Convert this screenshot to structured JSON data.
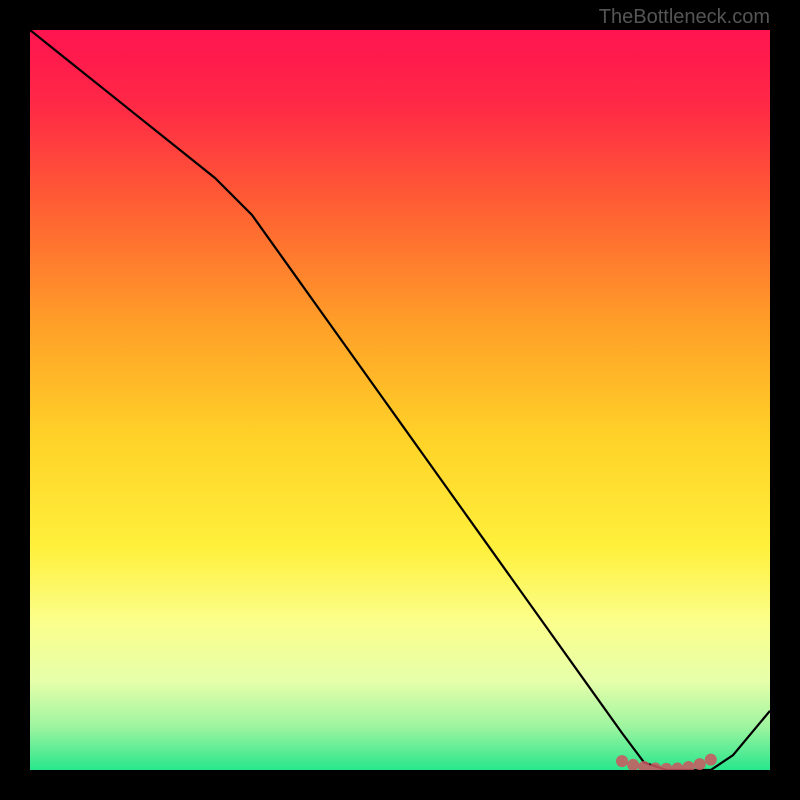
{
  "watermark": "TheBottleneck.com",
  "chart_data": {
    "type": "line",
    "title": "",
    "xlabel": "",
    "ylabel": "",
    "xlim": [
      0,
      100
    ],
    "ylim": [
      0,
      100
    ],
    "x": [
      0,
      5,
      10,
      15,
      20,
      25,
      30,
      35,
      40,
      45,
      50,
      55,
      60,
      65,
      70,
      75,
      80,
      83,
      86,
      89,
      92,
      95,
      100
    ],
    "values": [
      100,
      96,
      92,
      88,
      84,
      80,
      75,
      68,
      61,
      54,
      47,
      40,
      33,
      26,
      19,
      12,
      5,
      1,
      0,
      0,
      0,
      2,
      8
    ],
    "markers": {
      "x": [
        80,
        81.5,
        83,
        84.5,
        86,
        87.5,
        89,
        90.5,
        92
      ],
      "y": [
        1.2,
        0.7,
        0.4,
        0.2,
        0.15,
        0.2,
        0.4,
        0.8,
        1.4
      ],
      "color": "#cc5560",
      "size": 6
    },
    "gradient_stops": [
      {
        "offset": 0.0,
        "color": "#ff1450"
      },
      {
        "offset": 0.1,
        "color": "#ff2846"
      },
      {
        "offset": 0.25,
        "color": "#ff6432"
      },
      {
        "offset": 0.4,
        "color": "#ffa028"
      },
      {
        "offset": 0.55,
        "color": "#ffd228"
      },
      {
        "offset": 0.7,
        "color": "#fff03c"
      },
      {
        "offset": 0.8,
        "color": "#fbff8c"
      },
      {
        "offset": 0.88,
        "color": "#e6ffaa"
      },
      {
        "offset": 0.94,
        "color": "#a0f5a0"
      },
      {
        "offset": 1.0,
        "color": "#28e68c"
      }
    ],
    "line_color": "#000000",
    "line_width": 2.2
  }
}
